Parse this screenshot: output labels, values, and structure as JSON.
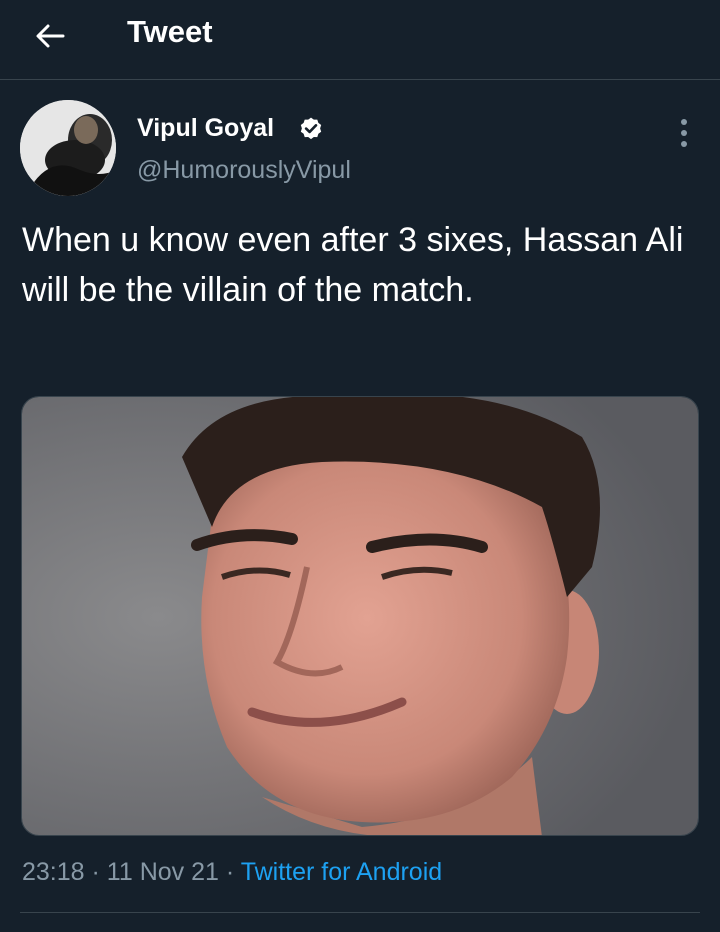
{
  "header": {
    "title": "Tweet",
    "back_icon": "arrow-left-icon"
  },
  "tweet": {
    "author_name": "Vipul Goyal",
    "author_handle": "@HumorouslyVipul",
    "verified_icon": "verified-badge-icon",
    "more_icon": "more-vertical-icon",
    "text": "When u know even after 3 sixes, Hassan Ali will be the villain of the match.",
    "time": "23:18",
    "date": "11 Nov 21",
    "separator": "·",
    "source": "Twitter for Android"
  },
  "colors": {
    "background": "#15202b",
    "divider": "#38444d",
    "secondary_text": "#8899a6",
    "link": "#1da1f2",
    "verified": "#ffffff"
  }
}
